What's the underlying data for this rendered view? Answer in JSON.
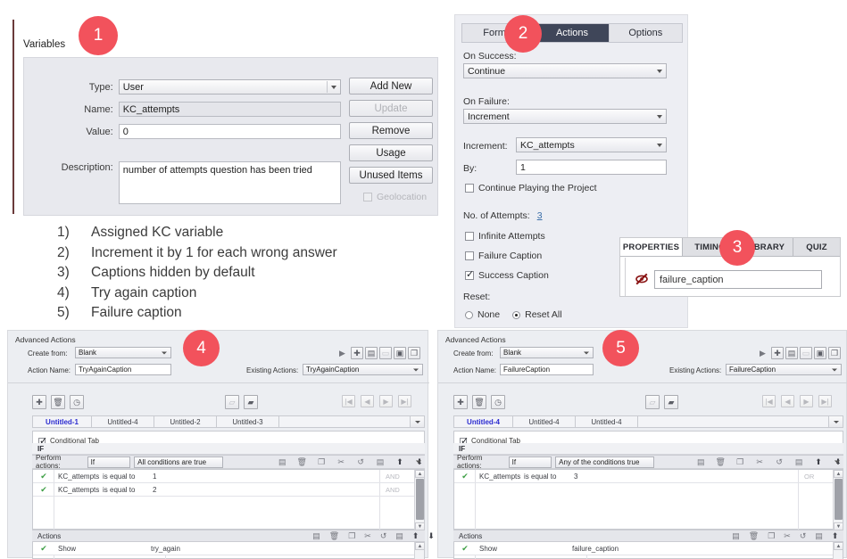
{
  "badges": [
    {
      "n": "1"
    },
    {
      "n": "2"
    },
    {
      "n": "3"
    },
    {
      "n": "4"
    },
    {
      "n": "5"
    }
  ],
  "variables_panel": {
    "title": "Variables",
    "fields": [
      {
        "label": "Type:",
        "value": "User",
        "kind": "select"
      },
      {
        "label": "Name:",
        "value": "KC_attempts",
        "kind": "input-gray"
      },
      {
        "label": "Value:",
        "value": "0",
        "kind": "input"
      },
      {
        "label": "Description:",
        "value": "number of attempts question has been tried",
        "kind": "textarea"
      }
    ],
    "buttons": [
      {
        "label": "Add New",
        "disabled": false
      },
      {
        "label": "Update",
        "disabled": true
      },
      {
        "label": "Remove",
        "disabled": false
      },
      {
        "label": "Usage",
        "disabled": false
      },
      {
        "label": "Unused Items",
        "disabled": false
      }
    ],
    "geolocation": {
      "label": "Geolocation",
      "checked": false,
      "disabled": true
    }
  },
  "quiz_panel": {
    "tabs": [
      {
        "label": "Format",
        "active": false
      },
      {
        "label": "Actions",
        "active": true
      },
      {
        "label": "Options",
        "active": false
      }
    ],
    "on_success_label": "On Success:",
    "on_success_value": "Continue",
    "on_failure_label": "On Failure:",
    "on_failure_value": "Increment",
    "increment_label": "Increment:",
    "increment_value": "KC_attempts",
    "by_label": "By:",
    "by_value": "1",
    "continue_playing": {
      "label": "Continue Playing the Project",
      "checked": false
    },
    "attempts_label": "No. of Attempts:",
    "attempts_value": "3",
    "infinite_attempts": {
      "label": "Infinite Attempts",
      "checked": false
    },
    "failure_caption": {
      "label": "Failure Caption",
      "checked": false
    },
    "success_caption": {
      "label": "Success Caption",
      "checked": true
    },
    "reset_label": "Reset:",
    "reset_options": [
      {
        "label": "None",
        "selected": false
      },
      {
        "label": "Reset All",
        "selected": true
      }
    ]
  },
  "properties_panel": {
    "tabs": [
      "PROPERTIES",
      "TIMING",
      "LIBRARY",
      "QUIZ"
    ],
    "active_tab": "PROPERTIES",
    "object_name": "failure_caption",
    "visibility_icon": "eye-slash-icon"
  },
  "notes": [
    {
      "num": "1)",
      "text": "Assigned KC variable"
    },
    {
      "num": "2)",
      "text": "Increment it by 1 for each wrong answer"
    },
    {
      "num": "3)",
      "text": "Captions hidden by default"
    },
    {
      "num": "4)",
      "text": "Try again caption"
    },
    {
      "num": "5)",
      "text": "Failure caption"
    }
  ],
  "advanced_actions_left": {
    "title": "Advanced Actions",
    "create_from_label": "Create from:",
    "create_from_value": "Blank",
    "action_name_label": "Action Name:",
    "action_name_value": "TryAgainCaption",
    "existing_actions_label": "Existing Actions:",
    "existing_actions_value": "TryAgainCaption",
    "toolbar_icons": [
      "play-icon",
      "add-icon",
      "save-as-icon",
      "open-icon",
      "delete-icon",
      "duplicate-icon"
    ],
    "left_icons": [
      "add-icon",
      "trash-icon",
      "history-icon"
    ],
    "mid_icons": [
      "import-icon",
      "export-icon"
    ],
    "nav_icons": [
      "first-icon",
      "prev-icon",
      "next-icon",
      "last-icon"
    ],
    "tabs": [
      {
        "label": "Untitled-1",
        "active": true
      },
      {
        "label": "Untitled-4",
        "active": false
      },
      {
        "label": "Untitled-2",
        "active": false
      },
      {
        "label": "Untitled-3",
        "active": false
      }
    ],
    "conditional_tab": {
      "label": "Conditional Tab",
      "checked": true
    },
    "if_label": "IF",
    "perform_actions_label": "Perform actions:",
    "perform_actions_value": "If",
    "condition_mode": "All conditions are true",
    "row_icons": [
      "add-row-icon",
      "trash-icon",
      "copy-icon",
      "cut-icon",
      "undo-icon",
      "insert-icon",
      "move-up-icon",
      "move-down-icon"
    ],
    "conditions": [
      {
        "variable": "KC_attempts",
        "operator": "is equal to",
        "value": "1",
        "connector": "AND"
      },
      {
        "variable": "KC_attempts",
        "operator": "is equal to",
        "value": "2",
        "connector": "AND"
      }
    ],
    "actions_label": "Actions",
    "actions": [
      {
        "command": "Show",
        "target": "try_again"
      }
    ]
  },
  "advanced_actions_right": {
    "title": "Advanced Actions",
    "create_from_label": "Create from:",
    "create_from_value": "Blank",
    "action_name_label": "Action Name:",
    "action_name_value": "FailureCaption",
    "existing_actions_label": "Existing Actions:",
    "existing_actions_value": "FailureCaption",
    "toolbar_icons": [
      "play-icon",
      "add-icon",
      "save-as-icon",
      "open-icon",
      "delete-icon",
      "duplicate-icon"
    ],
    "left_icons": [
      "add-icon",
      "trash-icon",
      "history-icon"
    ],
    "mid_icons": [
      "import-icon",
      "export-icon"
    ],
    "nav_icons": [
      "first-icon",
      "prev-icon",
      "next-icon",
      "last-icon"
    ],
    "tabs": [
      {
        "label": "Untitled-4",
        "active": true
      },
      {
        "label": "Untitled-4",
        "active": false
      },
      {
        "label": "Untitled-4",
        "active": false
      }
    ],
    "conditional_tab": {
      "label": "Conditional Tab",
      "checked": true
    },
    "if_label": "IF",
    "perform_actions_label": "Perform actions:",
    "perform_actions_value": "If",
    "condition_mode": "Any of the conditions true",
    "row_icons": [
      "add-row-icon",
      "trash-icon",
      "copy-icon",
      "cut-icon",
      "undo-icon",
      "insert-icon",
      "move-up-icon",
      "move-down-icon"
    ],
    "conditions": [
      {
        "variable": "KC_attempts",
        "operator": "is equal to",
        "value": "3",
        "connector": "OR"
      }
    ],
    "actions_label": "Actions",
    "actions": [
      {
        "command": "Show",
        "target": "failure_caption"
      }
    ]
  },
  "colors": {
    "badge_red": "#f2525c",
    "active_tab_navy": "#3f4659",
    "panel_bg": "#edeef3",
    "active_subtab_blue": "#2a2ad0",
    "check_green": "#3d9e45",
    "link_blue": "#3a6ea8"
  }
}
